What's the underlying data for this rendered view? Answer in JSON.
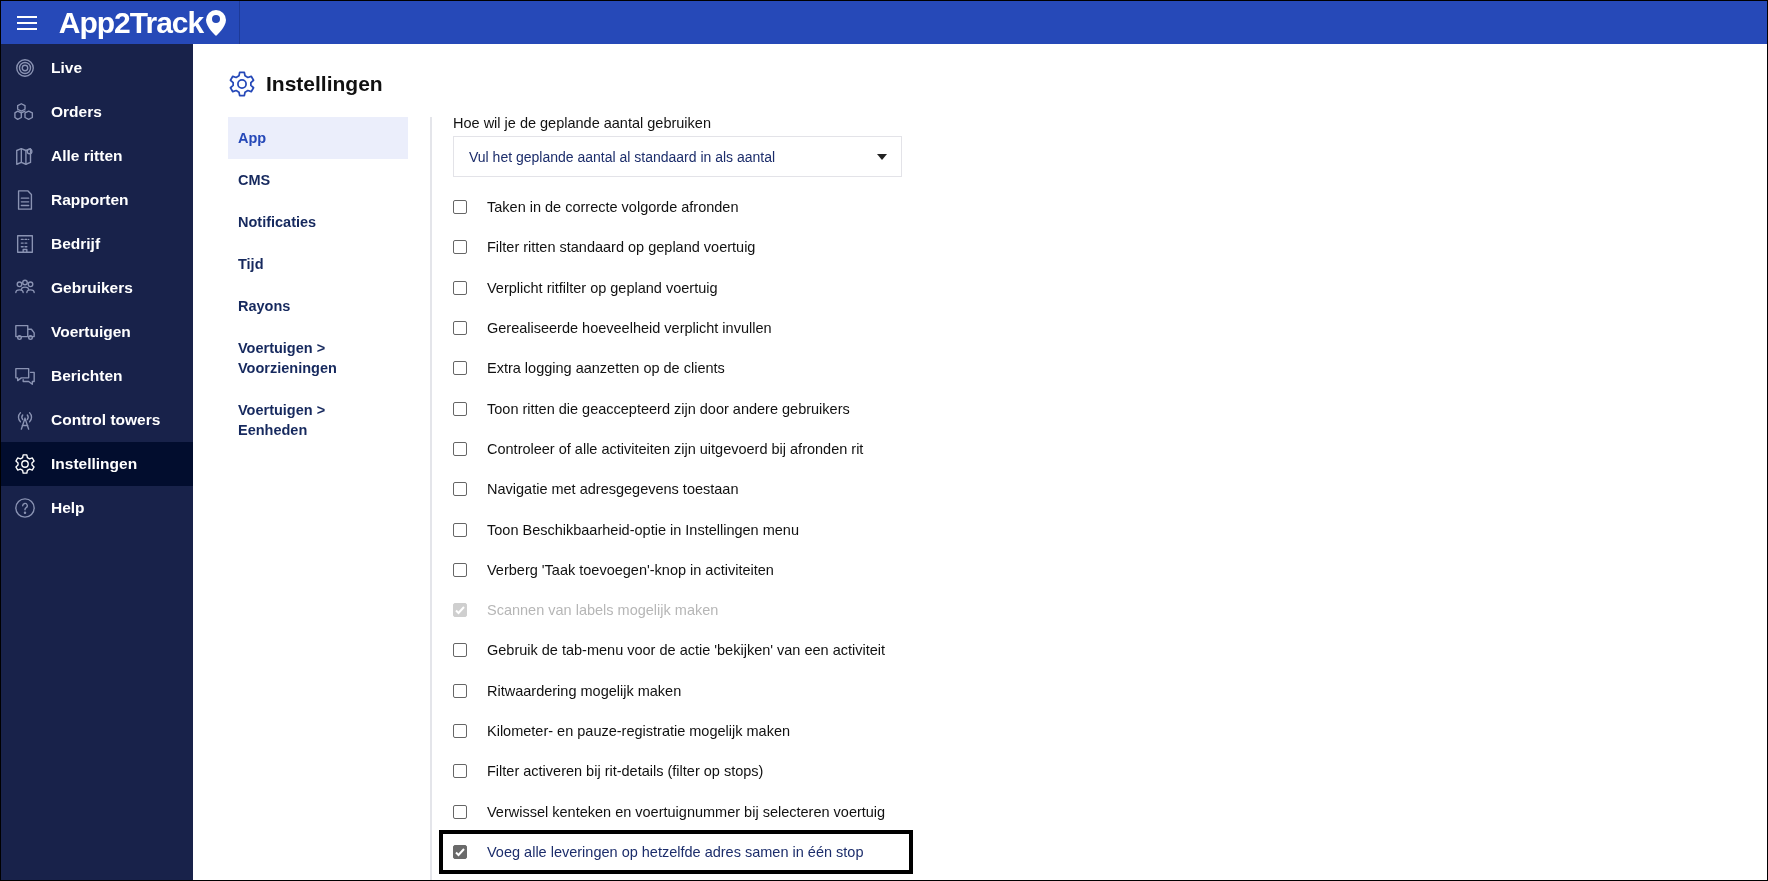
{
  "header": {
    "logo": "App2Track"
  },
  "sidebar": {
    "items": [
      {
        "label": "Live",
        "selected": false
      },
      {
        "label": "Orders",
        "selected": false
      },
      {
        "label": "Alle ritten",
        "selected": false
      },
      {
        "label": "Rapporten",
        "selected": false
      },
      {
        "label": "Bedrijf",
        "selected": false
      },
      {
        "label": "Gebruikers",
        "selected": false
      },
      {
        "label": "Voertuigen",
        "selected": false
      },
      {
        "label": "Berichten",
        "selected": false
      },
      {
        "label": "Control towers",
        "selected": false
      },
      {
        "label": "Instellingen",
        "selected": true
      },
      {
        "label": "Help",
        "selected": false
      }
    ]
  },
  "page": {
    "title": "Instellingen"
  },
  "submenu": [
    {
      "label": "App",
      "selected": true
    },
    {
      "label": "CMS",
      "selected": false
    },
    {
      "label": "Notificaties",
      "selected": false
    },
    {
      "label": "Tijd",
      "selected": false
    },
    {
      "label": "Rayons",
      "selected": false
    },
    {
      "label": "Voertuigen > Voorzieningen",
      "selected": false
    },
    {
      "label": "Voertuigen > Eenheden",
      "selected": false
    }
  ],
  "settings": {
    "select_label": "Hoe wil je de geplande aantal gebruiken",
    "select_value": "Vul het geplande aantal al standaard in als aantal",
    "options": [
      {
        "label": "Taken in de correcte volgorde afronden",
        "checked": false,
        "disabled": false,
        "highlighted": false
      },
      {
        "label": "Filter ritten standaard op gepland voertuig",
        "checked": false,
        "disabled": false,
        "highlighted": false
      },
      {
        "label": "Verplicht ritfilter op gepland voertuig",
        "checked": false,
        "disabled": false,
        "highlighted": false
      },
      {
        "label": "Gerealiseerde hoeveelheid verplicht invullen",
        "checked": false,
        "disabled": false,
        "highlighted": false
      },
      {
        "label": "Extra logging aanzetten op de clients",
        "checked": false,
        "disabled": false,
        "highlighted": false
      },
      {
        "label": "Toon ritten die geaccepteerd zijn door andere gebruikers",
        "checked": false,
        "disabled": false,
        "highlighted": false
      },
      {
        "label": "Controleer of alle activiteiten zijn uitgevoerd bij afronden rit",
        "checked": false,
        "disabled": false,
        "highlighted": false
      },
      {
        "label": "Navigatie met adresgegevens toestaan",
        "checked": false,
        "disabled": false,
        "highlighted": false
      },
      {
        "label": "Toon Beschikbaarheid-optie in Instellingen menu",
        "checked": false,
        "disabled": false,
        "highlighted": false
      },
      {
        "label": "Verberg 'Taak toevoegen'-knop in activiteiten",
        "checked": false,
        "disabled": false,
        "highlighted": false
      },
      {
        "label": "Scannen van labels mogelijk maken",
        "checked": true,
        "disabled": true,
        "highlighted": false
      },
      {
        "label": "Gebruik de tab-menu voor de actie 'bekijken' van een activiteit",
        "checked": false,
        "disabled": false,
        "highlighted": false
      },
      {
        "label": "Ritwaardering mogelijk maken",
        "checked": false,
        "disabled": false,
        "highlighted": false
      },
      {
        "label": "Kilometer- en pauze-registratie mogelijk maken",
        "checked": false,
        "disabled": false,
        "highlighted": false
      },
      {
        "label": "Filter activeren bij rit-details (filter op stops)",
        "checked": false,
        "disabled": false,
        "highlighted": false
      },
      {
        "label": "Verwissel kenteken en voertuignummer bij selecteren voertuig",
        "checked": false,
        "disabled": false,
        "highlighted": false
      },
      {
        "label": "Voeg alle leveringen op hetzelfde adres samen in één stop",
        "checked": true,
        "disabled": false,
        "highlighted": true
      }
    ]
  }
}
